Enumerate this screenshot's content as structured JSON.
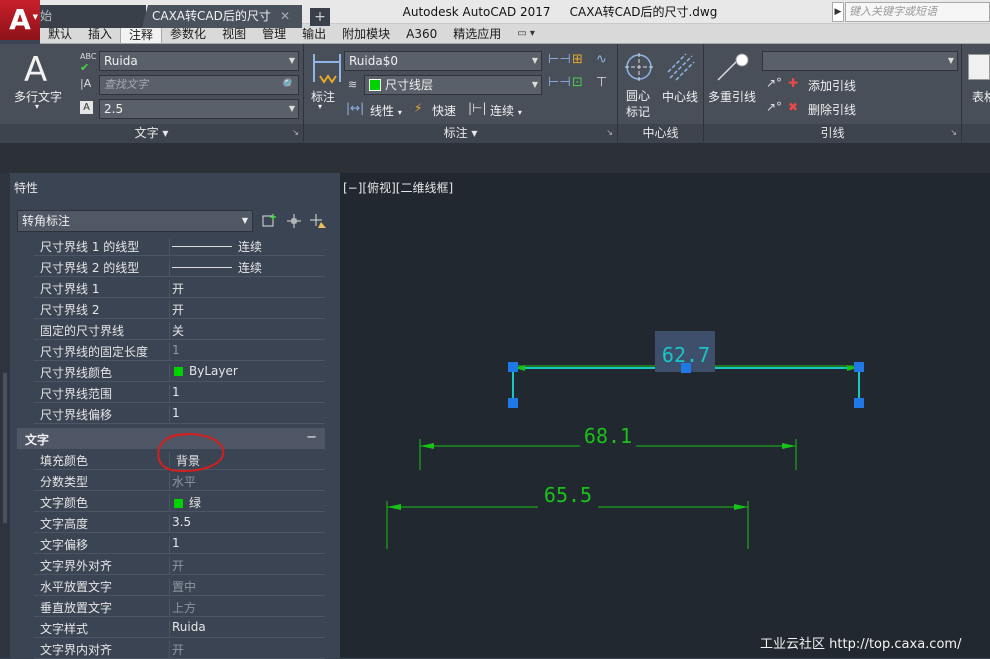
{
  "app": {
    "logo_letter": "A",
    "title": "Autodesk AutoCAD 2017     CAXA转CAD后的尺寸.dwg",
    "search_placeholder": "键入关键字或短语"
  },
  "ribbon_tabs": [
    "默认",
    "插入",
    "注释",
    "参数化",
    "视图",
    "管理",
    "输出",
    "附加模块",
    "A360",
    "精选应用"
  ],
  "ribbon_active_tab": "注释",
  "text_panel": {
    "big_button_label": "多行文字",
    "style_value": "Ruida",
    "find_placeholder": "查找文字",
    "height_value": "2.5",
    "title": "文字"
  },
  "dim_panel": {
    "big_button_label": "标注",
    "dimstyle_value": "Ruida$0",
    "layer_value": "尺寸线层",
    "linear_label": "线性",
    "quick_label": "快速",
    "continue_label": "连续",
    "title": "标注"
  },
  "centerline_panel": {
    "center_mark_label": "圆心\n标记",
    "centerline_label": "中心线",
    "title": "中心线"
  },
  "leader_panel": {
    "mleader_label": "多重引线",
    "add_leader_label": "添加引线",
    "remove_leader_label": "删除引线",
    "title": "引线",
    "table_label": "表格"
  },
  "doc_tabs": {
    "start": "开始",
    "file": "CAXA转CAD后的尺寸",
    "new_tab": "+"
  },
  "properties": {
    "title": "特性",
    "selection": "转角标注",
    "rows_top": [
      {
        "key": "尺寸界线 1 的线型",
        "value": "连续",
        "line": true
      },
      {
        "key": "尺寸界线 2 的线型",
        "value": "连续",
        "line": true
      },
      {
        "key": "尺寸界线 1",
        "value": "开"
      },
      {
        "key": "尺寸界线 2",
        "value": "开"
      },
      {
        "key": "固定的尺寸界线",
        "value": "关"
      },
      {
        "key": "尺寸界线的固定长度",
        "value": "1",
        "dim": true
      },
      {
        "key": "尺寸界线颜色",
        "value": "ByLayer",
        "swatch": true
      },
      {
        "key": "尺寸界线范围",
        "value": "1"
      },
      {
        "key": "尺寸界线偏移",
        "value": "1"
      }
    ],
    "section_text": {
      "label": "文字",
      "toggle": "−"
    },
    "rows_text": [
      {
        "key": "填充颜色",
        "value": "背景"
      },
      {
        "key": "分数类型",
        "value": "水平",
        "dim": true
      },
      {
        "key": "文字颜色",
        "value": "绿",
        "swatch": true
      },
      {
        "key": "文字高度",
        "value": "3.5"
      },
      {
        "key": "文字偏移",
        "value": "1"
      },
      {
        "key": "文字界外对齐",
        "value": "开",
        "dim": true
      },
      {
        "key": "水平放置文字",
        "value": "置中",
        "dim": true
      },
      {
        "key": "垂直放置文字",
        "value": "上方",
        "dim": true
      },
      {
        "key": "文字样式",
        "value": "Ruida"
      },
      {
        "key": "文字界内对齐",
        "value": "开",
        "dim": true
      }
    ]
  },
  "drawing": {
    "view_label": "[−][俯视][二维线框]",
    "dim_selected": "62.7",
    "dim_2": "68.1",
    "dim_3": "65.5",
    "watermark": "工业云社区 http://top.caxa.com/",
    "colors": {
      "dim_green": "#19c219",
      "text_cyan": "#19c5c5",
      "grip_blue": "#1e78e6",
      "background": "#212830"
    }
  }
}
